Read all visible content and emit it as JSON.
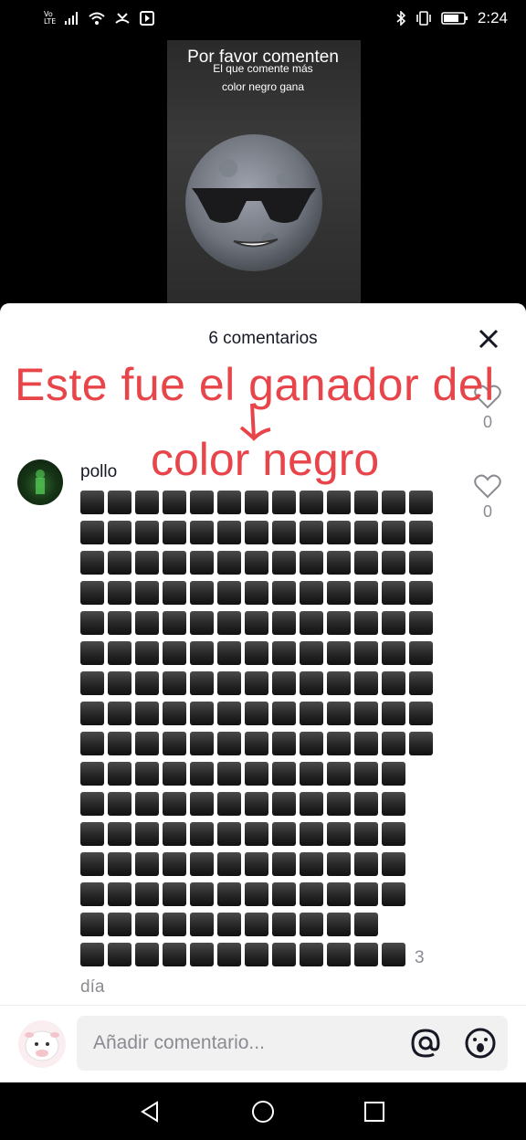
{
  "status_bar": {
    "network_label_top": "Vo",
    "network_label_bottom": "LTE",
    "time": "2:24",
    "icons": [
      "signal-icon",
      "wifi-icon",
      "missed-call-icon",
      "play-store-icon",
      "bluetooth-icon",
      "vibrate-icon",
      "battery-icon"
    ]
  },
  "video": {
    "title": "Por favor comenten",
    "subtitle_line1": "El que comente más",
    "subtitle_line2": "color negro gana",
    "image": "sunglasses-moon-emoji"
  },
  "comments": {
    "header": "6 comentarios",
    "close_icon": "close-icon",
    "overlay_line1": "Este fue el ganador del",
    "overlay_line2": "color negro",
    "prev_like_count": "0",
    "comment": {
      "username": "pollo",
      "content": "⬛⬛⬛⬛⬛⬛⬛⬛⬛⬛⬛⬛⬛⬛⬛⬛⬛⬛⬛⬛⬛⬛⬛⬛⬛⬛⬛⬛⬛⬛⬛⬛⬛⬛⬛⬛⬛⬛⬛⬛⬛⬛⬛⬛⬛⬛⬛⬛⬛⬛⬛⬛⬛⬛⬛⬛⬛⬛⬛⬛⬛⬛⬛⬛⬛⬛⬛⬛⬛⬛⬛⬛⬛⬛⬛⬛⬛⬛⬛⬛⬛⬛⬛⬛⬛⬛⬛⬛⬛⬛⬛⬛⬛⬛⬛⬛⬛⬛⬛⬛⬛⬛⬛⬛⬛⬛⬛⬛⬛⬛⬛⬛⬛⬛⬛⬛⬛⬛⬛⬛⬛⬛⬛⬛⬛⬛⬛⬛⬛⬛⬛⬛⬛⬛⬛⬛⬛⬛⬛⬛⬛⬛⬛⬛⬛⬛⬛⬛⬛⬛⬛⬛⬛⬛⬛⬛⬛⬛⬛⬛⬛⬛⬛⬛⬛⬛⬛⬛⬛⬛⬛⬛⬛⬛⬛⬛⬛⬛⬛⬛⬛⬛⬛⬛⬛⬛⬛⬛⬛⬛⬛⬛⬛⬛",
      "square_rows": [
        13,
        13,
        13,
        13,
        13,
        13,
        13,
        13,
        13,
        12,
        12,
        12,
        12,
        12,
        11,
        12
      ],
      "time_part1": "3",
      "time_part2": "día",
      "like_count": "0"
    }
  },
  "composer": {
    "placeholder": "Añadir comentario...",
    "at_icon": "at-icon",
    "emoji_icon": "emoji-icon"
  },
  "nav": [
    "back-icon",
    "home-icon",
    "recents-icon"
  ],
  "colors": {
    "overlay_text": "#e8454a",
    "muted": "#8a8b91",
    "text": "#161823"
  }
}
